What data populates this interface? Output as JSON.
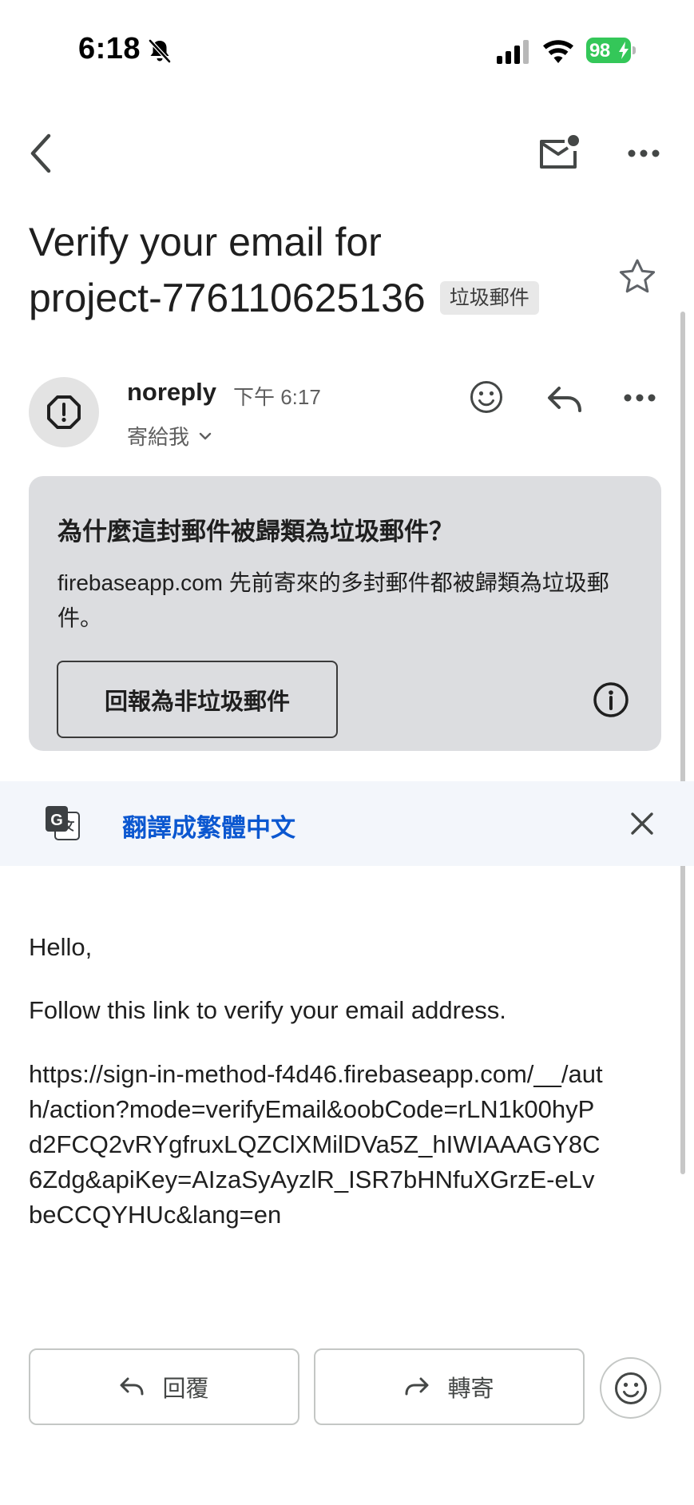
{
  "status_bar": {
    "time": "6:18",
    "battery_percent": "98"
  },
  "email": {
    "subject_line1": "Verify your email for",
    "subject_line2": "project-776110625136",
    "label": "垃圾郵件",
    "sender": {
      "name": "noreply",
      "time": "下午 6:17",
      "recipient": "寄給我"
    }
  },
  "spam_notice": {
    "title": "為什麼這封郵件被歸類為垃圾郵件？",
    "description": "firebaseapp.com 先前寄來的多封郵件都被歸類為垃圾郵件。",
    "report_button": "回報為非垃圾郵件"
  },
  "translate": {
    "link_text": "翻譯成繁體中文"
  },
  "body": {
    "greeting": "Hello,",
    "instruction": "Follow this link to verify your email address.",
    "link": "https://sign-in-method-f4d46.firebaseapp.com/__/auth/action?mode=verifyEmail&oobCode=rLN1k00hyPd2FCQ2vRYgfruxLQZClXMilDVa5Z_hIWIAAAGY8C6Zdg&apiKey=AIzaSyAyzlR_ISR7bHNfuXGrzE-eLvbeCCQYHUc&lang=en"
  },
  "actions": {
    "reply": "回覆",
    "forward": "轉寄"
  },
  "icons": {
    "back": "chevron-left-icon",
    "mark_unread": "mail-unread-icon",
    "more": "more-horizontal-icon",
    "star": "star-outline-icon",
    "avatar": "spam-warning-icon",
    "emoji": "emoji-smile-icon",
    "reply": "reply-arrow-icon",
    "info": "info-icon",
    "translate": "google-translate-icon",
    "close": "close-icon",
    "forward": "forward-arrow-icon"
  },
  "colors": {
    "link_blue": "#0b57d0",
    "spam_card_bg": "#dcdde0",
    "translate_bar_bg": "#f3f6fb",
    "battery_green": "#34c759"
  }
}
